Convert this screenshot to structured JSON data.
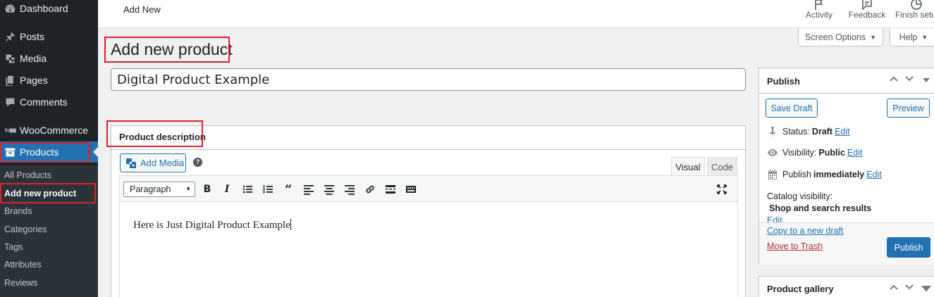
{
  "sidebar": {
    "items": [
      {
        "label": "Dashboard",
        "icon": "dashboard-icon"
      },
      {
        "label": "Posts",
        "icon": "pin-icon"
      },
      {
        "label": "Media",
        "icon": "media-icon"
      },
      {
        "label": "Pages",
        "icon": "pages-icon"
      },
      {
        "label": "Comments",
        "icon": "comment-icon"
      },
      {
        "label": "WooCommerce",
        "icon": "woocommerce-icon"
      },
      {
        "label": "Products",
        "icon": "archive-icon"
      }
    ],
    "submenu": [
      "All Products",
      "Add new product",
      "Brands",
      "Categories",
      "Tags",
      "Attributes",
      "Reviews"
    ]
  },
  "topbar": {
    "title": "Add New",
    "actions": [
      {
        "label": "Activity",
        "icon": "flag-icon"
      },
      {
        "label": "Feedback",
        "icon": "feedback-icon"
      },
      {
        "label": "Finish setu",
        "icon": "progress-icon"
      }
    ]
  },
  "screen_options": {
    "screen_label": "Screen Options",
    "help_label": "Help"
  },
  "page": {
    "heading": "Add new product"
  },
  "title_input": {
    "value": "Digital Product Example"
  },
  "description": {
    "title": "Product description",
    "add_media_label": "Add Media",
    "help_mark": "?",
    "tabs": [
      "Visual",
      "Code"
    ],
    "format_select": "Paragraph",
    "content": "Here is Just Digital Product Example"
  },
  "publish": {
    "title": "Publish",
    "save_draft": "Save Draft",
    "preview": "Preview",
    "status_label": "Status:",
    "status_value": "Draft",
    "visibility_label": "Visibility:",
    "visibility_value": "Public",
    "publish_label": "Publish",
    "publish_value": "immediately",
    "edit": "Edit",
    "catalog_label": "Catalog visibility:",
    "catalog_value": "Shop and search results",
    "copy_draft": "Copy to a new draft",
    "trash": "Move to Trash",
    "publish_button": "Publish"
  },
  "gallery": {
    "title": "Product gallery"
  },
  "colors": {
    "accent": "#2271b1",
    "sidebar": "#1d2327",
    "highlight": "#d6232e"
  }
}
